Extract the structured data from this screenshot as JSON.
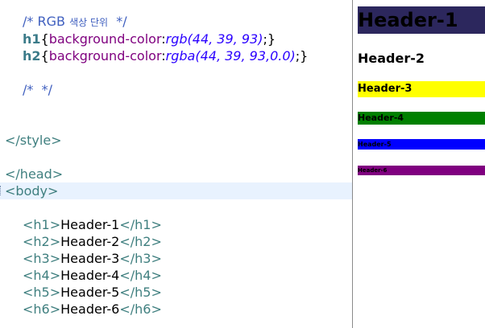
{
  "editor": {
    "lines": {
      "comment1_open": "/* RGB ",
      "comment1_korean": "색상 단위",
      "comment1_close": "  */",
      "h1_selector": "h1",
      "h1_brace_open": "{",
      "h1_property": "background-color",
      "h1_colon": ":",
      "h1_value": "rgb(44, 39, 93)",
      "h1_semi": ";",
      "h1_brace_close": "}",
      "h2_selector": "h2",
      "h2_brace_open": "{",
      "h2_property": "background-color",
      "h2_colon": ":",
      "h2_value": "rgba(44, 39, 93,0.0)",
      "h2_semi": ";",
      "h2_brace_close": "}",
      "comment2": "/*  */",
      "style_close": "</style>",
      "head_close": "</head>",
      "body_open": "<body>",
      "h_lines": [
        {
          "open": "<h1>",
          "text": "Header-1",
          "close": "</h1>"
        },
        {
          "open": "<h2>",
          "text": "Header-2",
          "close": "</h2>"
        },
        {
          "open": "<h3>",
          "text": "Header-3",
          "close": "</h3>"
        },
        {
          "open": "<h4>",
          "text": "Header-4",
          "close": "</h4>"
        },
        {
          "open": "<h5>",
          "text": "Header-5",
          "close": "</h5>"
        },
        {
          "open": "<h6>",
          "text": "Header-6",
          "close": "</h6>"
        }
      ]
    },
    "colors": {
      "comment": "#3f5fbf",
      "selector": "#3b7b89",
      "property": "#7f007f",
      "value": "#2a00ff",
      "tag": "#3f7f7f",
      "current_line": "#e8f2fe"
    }
  },
  "preview": {
    "headers": [
      {
        "label": "Header-1",
        "background": "#2c275d"
      },
      {
        "label": "Header-2",
        "background": "transparent"
      },
      {
        "label": "Header-3",
        "background": "#ffff00"
      },
      {
        "label": "Header-4",
        "background": "#008000"
      },
      {
        "label": "Header-5",
        "background": "#0000ff"
      },
      {
        "label": "Header-6",
        "background": "#800080"
      }
    ]
  }
}
